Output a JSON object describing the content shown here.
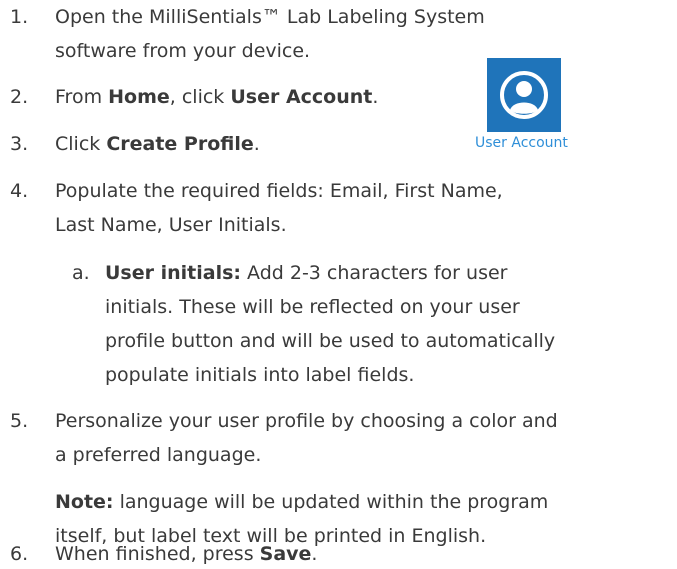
{
  "steps": [
    {
      "n": "1.",
      "lines": [
        "Open the MilliSentials™ Lab Labeling System",
        "software from your device."
      ]
    },
    {
      "n": "2.",
      "pre": "From ",
      "b1": "Home",
      "mid": ", click ",
      "b2": "User Account",
      "post": "."
    },
    {
      "n": "3.",
      "pre": "Click ",
      "b1": "Create Profile",
      "post": "."
    },
    {
      "n": "4.",
      "lines": [
        "Populate the required fields: Email, First Name,",
        "Last Name, User Initials."
      ]
    },
    {
      "n": "5.",
      "lines": [
        "Personalize your user profile by choosing a color and",
        "a preferred language."
      ]
    },
    {
      "n": "6.",
      "pre": "When finished, press ",
      "b1": "Save",
      "post": "."
    }
  ],
  "substep": {
    "n": "a.",
    "bold": "User initials:",
    "lines": [
      " Add 2-3 characters for user",
      "initials. These will be reflected on your user",
      "profile button and will be used to automatically",
      "populate initials into label fields."
    ]
  },
  "note": {
    "bold": "Note:",
    "lines": [
      " language will be updated within the program",
      "itself, but label text will be printed in English."
    ]
  },
  "user_account": {
    "label": "User Account",
    "icon": "user-profile-icon",
    "tile_color": "#1f74ba",
    "label_color": "#2f8fd8"
  }
}
